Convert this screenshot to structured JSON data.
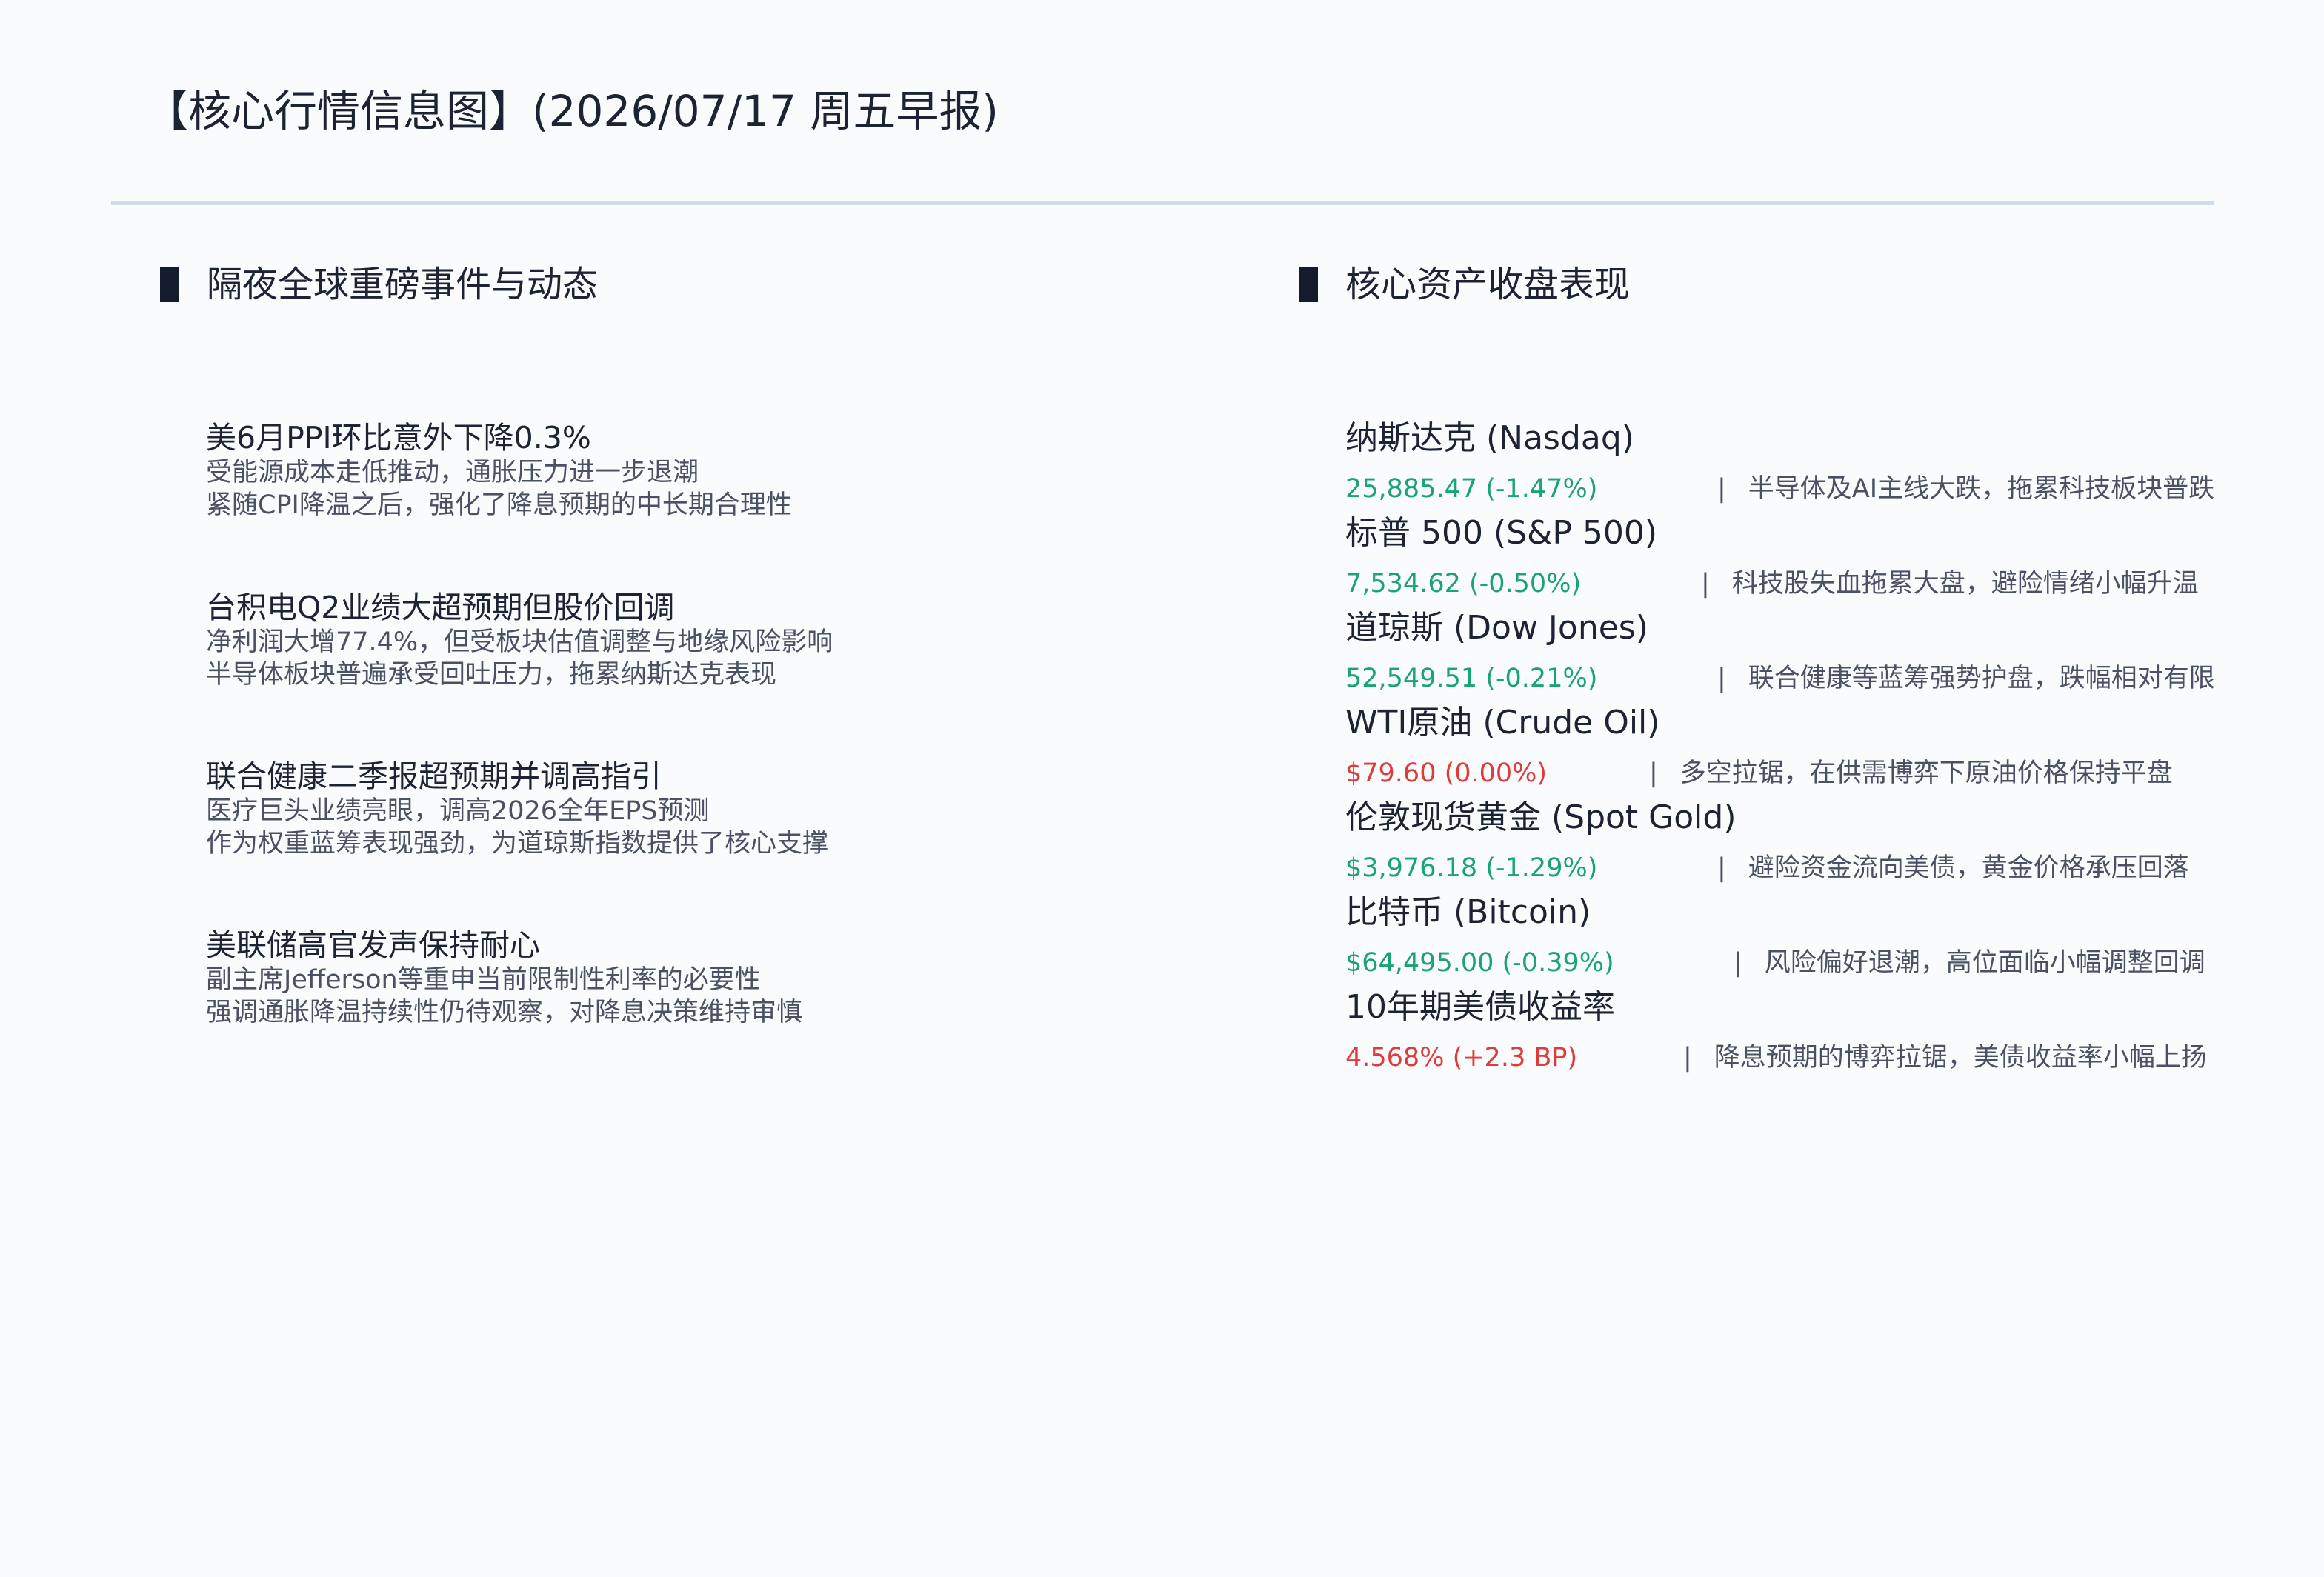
{
  "page": {
    "title": "【核心行情信息图】(2026/07/17 周五早报)"
  },
  "colors": {
    "down": "#1aa374",
    "flat_up": "#e03b3b",
    "text": "#1c2333",
    "subtext": "#4a5163",
    "divider": "#cfdcea",
    "accent_bar": "#141b2d"
  },
  "left_section": {
    "title": "隔夜全球重磅事件与动态",
    "items": [
      {
        "headline": "美6月PPI环比意外下降0.3%",
        "lines": [
          "受能源成本走低推动，通胀压力进一步退潮",
          "紧随CPI降温之后，强化了降息预期的中长期合理性"
        ]
      },
      {
        "headline": "台积电Q2业绩大超预期但股价回调",
        "lines": [
          "净利润大增77.4%，但受板块估值调整与地缘风险影响",
          "半导体板块普遍承受回吐压力，拖累纳斯达克表现"
        ]
      },
      {
        "headline": "联合健康二季报超预期并调高指引",
        "lines": [
          "医疗巨头业绩亮眼，调高2026全年EPS预测",
          "作为权重蓝筹表现强劲，为道琼斯指数提供了核心支撑"
        ]
      },
      {
        "headline": "美联储高官发声保持耐心",
        "lines": [
          "副主席Jefferson等重申当前限制性利率的必要性",
          "强调通胀降温持续性仍待观察，对降息决策维持审慎"
        ]
      }
    ]
  },
  "right_section": {
    "title": "核心资产收盘表现",
    "separator": "|",
    "assets": [
      {
        "name": "纳斯达克 (Nasdaq)",
        "value": "25,885.47 (-1.47%)",
        "direction": "down",
        "note": "半导体及AI主线大跌，拖累科技板块普跌"
      },
      {
        "name": "标普 500 (S&P 500)",
        "value": "7,534.62 (-0.50%)",
        "direction": "down",
        "note": "科技股失血拖累大盘，避险情绪小幅升温"
      },
      {
        "name": "道琼斯 (Dow Jones)",
        "value": "52,549.51 (-0.21%)",
        "direction": "down",
        "note": "联合健康等蓝筹强势护盘，跌幅相对有限"
      },
      {
        "name": "WTI原油 (Crude Oil)",
        "value": "$79.60 (0.00%)",
        "direction": "up",
        "note": "多空拉锯，在供需博弈下原油价格保持平盘"
      },
      {
        "name": "伦敦现货黄金 (Spot Gold)",
        "value": "$3,976.18 (-1.29%)",
        "direction": "down",
        "note": "避险资金流向美债，黄金价格承压回落"
      },
      {
        "name": "比特币 (Bitcoin)",
        "value": "$64,495.00 (-0.39%)",
        "direction": "down",
        "note": "风险偏好退潮，高位面临小幅调整回调"
      },
      {
        "name": "10年期美债收益率",
        "value": "4.568% (+2.3 BP)",
        "direction": "up",
        "note": "降息预期的博弈拉锯，美债收益率小幅上扬"
      }
    ]
  }
}
